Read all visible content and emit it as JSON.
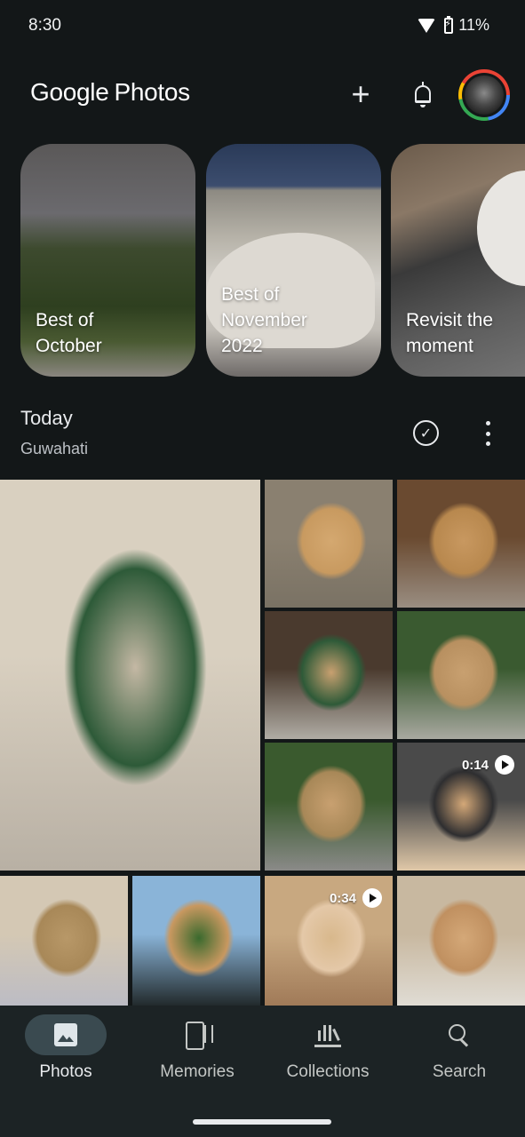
{
  "status_bar": {
    "time": "8:30",
    "battery": "11%",
    "wifi_icon": "wifi-icon",
    "battery_icon": "battery-charging-icon"
  },
  "header": {
    "logo_google": "Google",
    "logo_photos": "Photos",
    "add_icon": "plus-icon",
    "notifications_icon": "bell-icon",
    "avatar": "account-avatar"
  },
  "memories": [
    {
      "label": "Best of\nOctober"
    },
    {
      "label": "Best of\nNovember\n2022"
    },
    {
      "label": "Revisit the\nmoment"
    }
  ],
  "section": {
    "title": "Today",
    "location": "Guwahati",
    "select_icon": "check-circle-icon",
    "more_icon": "more-vert-icon"
  },
  "grid": {
    "photos": [
      {
        "id": "p1",
        "kind": "photo",
        "colors": [
          "#d9d0c0",
          "#c4b8a4",
          "#2d5a38",
          "#b8b0a4"
        ]
      },
      {
        "id": "p2",
        "kind": "photo",
        "colors": [
          "#8a8070",
          "#d4a870",
          "#c89a60",
          "#7a7264"
        ]
      },
      {
        "id": "p3",
        "kind": "photo",
        "colors": [
          "#6a4a30",
          "#c89860",
          "#b8884e",
          "#9a8e82"
        ]
      },
      {
        "id": "p4",
        "kind": "photo",
        "colors": [
          "#4a3a2e",
          "#c8a070",
          "#2e5a38",
          "#b0aca4"
        ]
      },
      {
        "id": "p5",
        "kind": "photo",
        "colors": [
          "#3a5a30",
          "#c8a070",
          "#b89060",
          "#a8a8a0"
        ]
      },
      {
        "id": "p6",
        "kind": "photo",
        "colors": [
          "#3a5a2e",
          "#c8a070",
          "#a88858",
          "#8a8a88"
        ]
      },
      {
        "id": "p7",
        "kind": "video",
        "duration": "0:14",
        "colors": [
          "#4a4a4a",
          "#d4a878",
          "#2e2e30",
          "#e0c8a8"
        ]
      },
      {
        "id": "p8",
        "kind": "photo",
        "colors": [
          "#d4c8b4",
          "#b89868",
          "#a88858",
          "#bcbcc4"
        ]
      },
      {
        "id": "p9",
        "kind": "photo",
        "colors": [
          "#8ab4d8",
          "#3a6a2e",
          "#c89860",
          "#222a2c"
        ]
      },
      {
        "id": "p10",
        "kind": "video",
        "duration": "0:34",
        "colors": [
          "#c8a880",
          "#d8b88c",
          "#e4c8a8",
          "#a07a58"
        ]
      },
      {
        "id": "p11",
        "kind": "photo",
        "colors": [
          "#c8b8a0",
          "#d4a878",
          "#c09060",
          "#e0dcd4"
        ]
      }
    ]
  },
  "bottom_nav": {
    "items": [
      {
        "label": "Photos",
        "icon": "photos-icon",
        "active": true
      },
      {
        "label": "Memories",
        "icon": "memories-icon",
        "active": false
      },
      {
        "label": "Collections",
        "icon": "collections-icon",
        "active": false
      },
      {
        "label": "Search",
        "icon": "search-icon",
        "active": false
      }
    ]
  }
}
